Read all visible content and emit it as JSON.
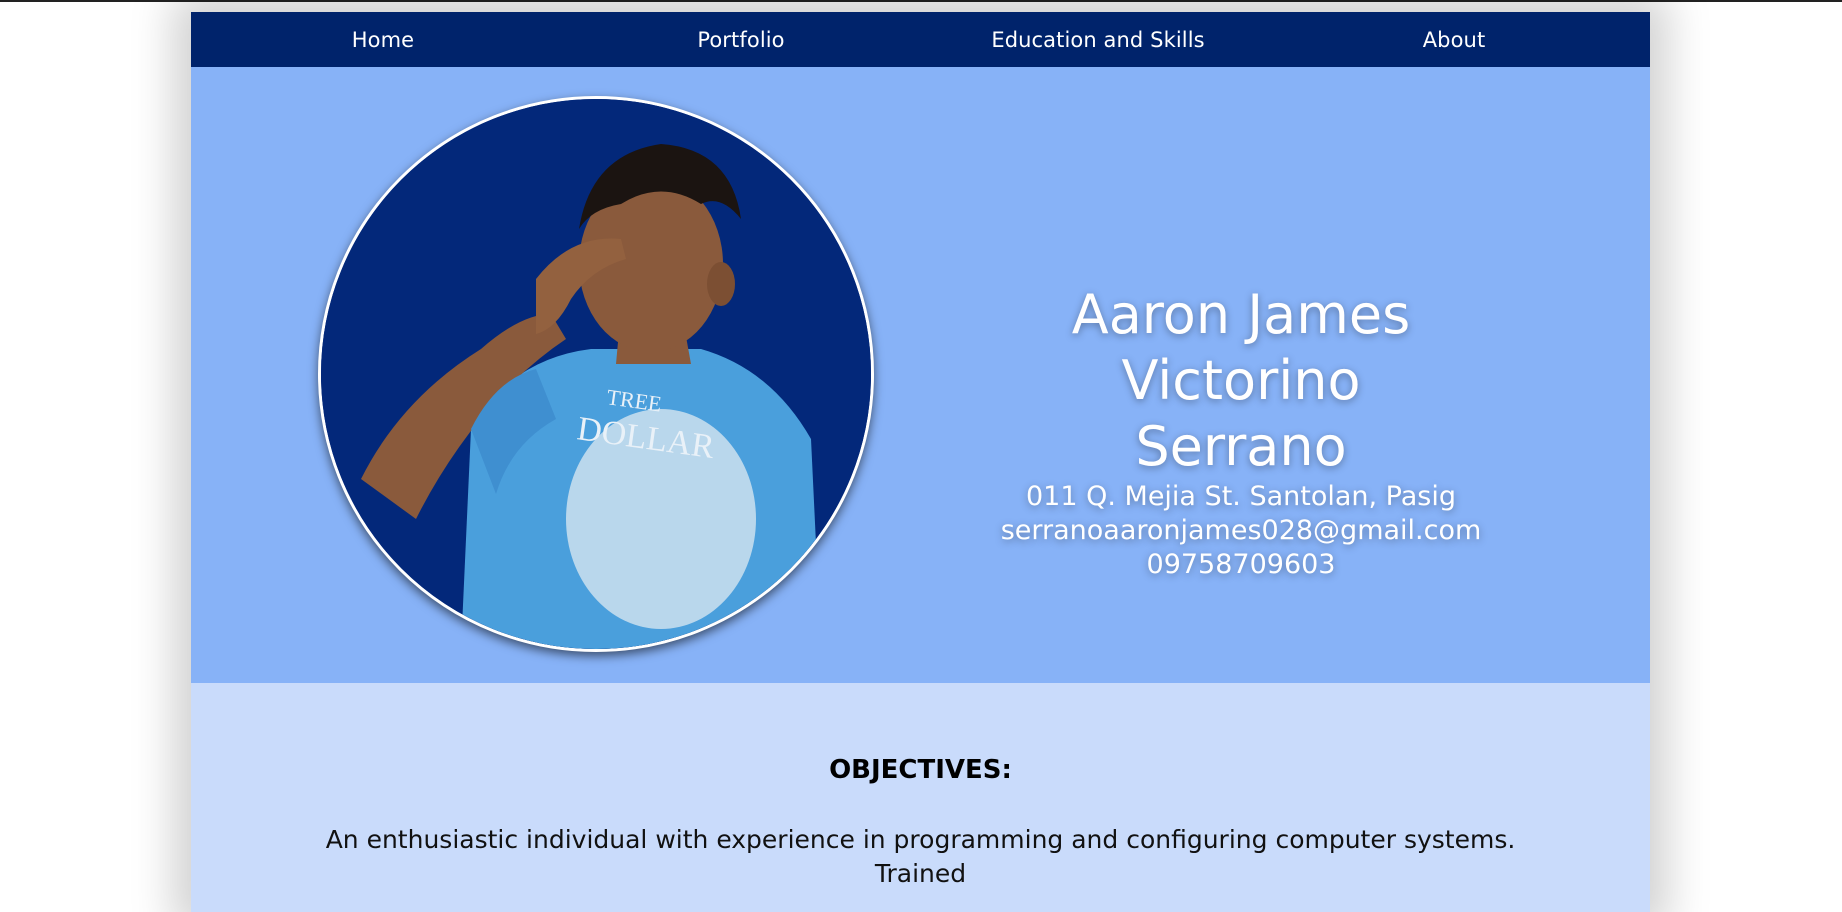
{
  "nav": {
    "items": [
      {
        "label": "Home"
      },
      {
        "label": "Portfolio"
      },
      {
        "label": "Education and Skills"
      },
      {
        "label": "About"
      }
    ]
  },
  "hero": {
    "name_line1": "Aaron James Victorino",
    "name_line2": "Serrano",
    "address": "011 Q. Mejia St. Santolan, Pasig",
    "email": "serranoaaronjames028@gmail.com",
    "phone": "09758709603"
  },
  "objectives": {
    "title": "OBJECTIVES:",
    "text": "An enthusiastic individual with experience in programming and configuring computer systems. Trained"
  },
  "colors": {
    "nav_bg": "#00236b",
    "hero_bg": "#87b2f7",
    "content_bg": "#c9dbfb",
    "photo_bg": "#03287a"
  }
}
